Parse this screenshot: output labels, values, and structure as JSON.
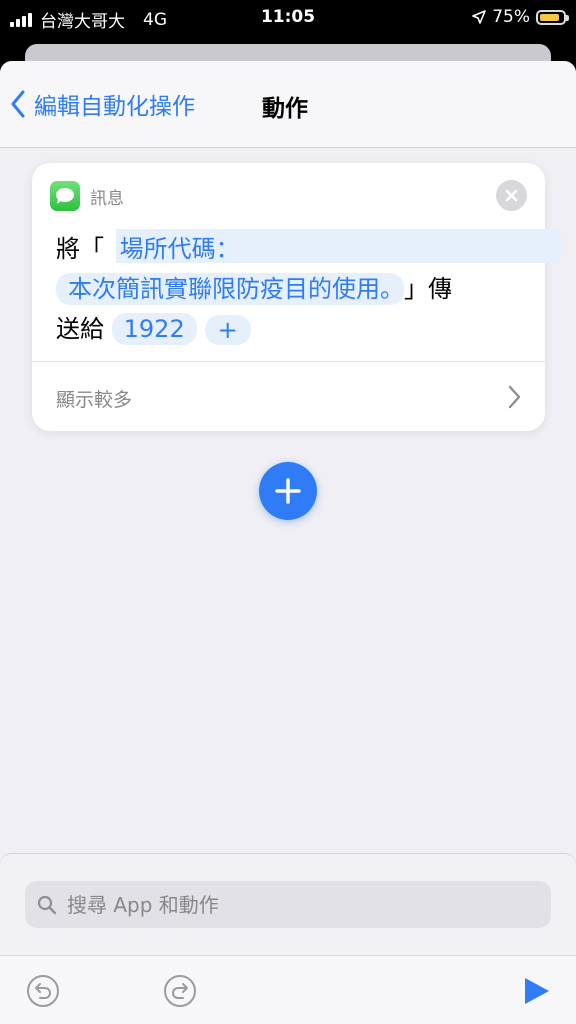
{
  "status_bar": {
    "carrier": "台灣大哥大",
    "network": "4G",
    "time": "11:05",
    "battery": "75%",
    "battery_color": "#f6c744"
  },
  "nav": {
    "back_label": "編輯自動化操作",
    "title": "動作"
  },
  "action_card": {
    "app_name": "訊息",
    "word_send": "將「",
    "message_line1": "場所代碼：",
    "message_line2": "本次簡訊實聯限防疫目的使用。",
    "word_close": "」傳",
    "word_to": "送給",
    "recipient": "1922",
    "add_recipient": "+",
    "show_more": "顯示較多"
  },
  "search": {
    "placeholder": "搜尋 App 和動作"
  },
  "toolbar": {
    "undo_icon": "undo-icon",
    "redo_icon": "redo-icon",
    "run_icon": "play-icon"
  },
  "colors": {
    "accent": "#2f7cf6",
    "token_bg": "#e6f0fd",
    "background": "#efeff4"
  }
}
